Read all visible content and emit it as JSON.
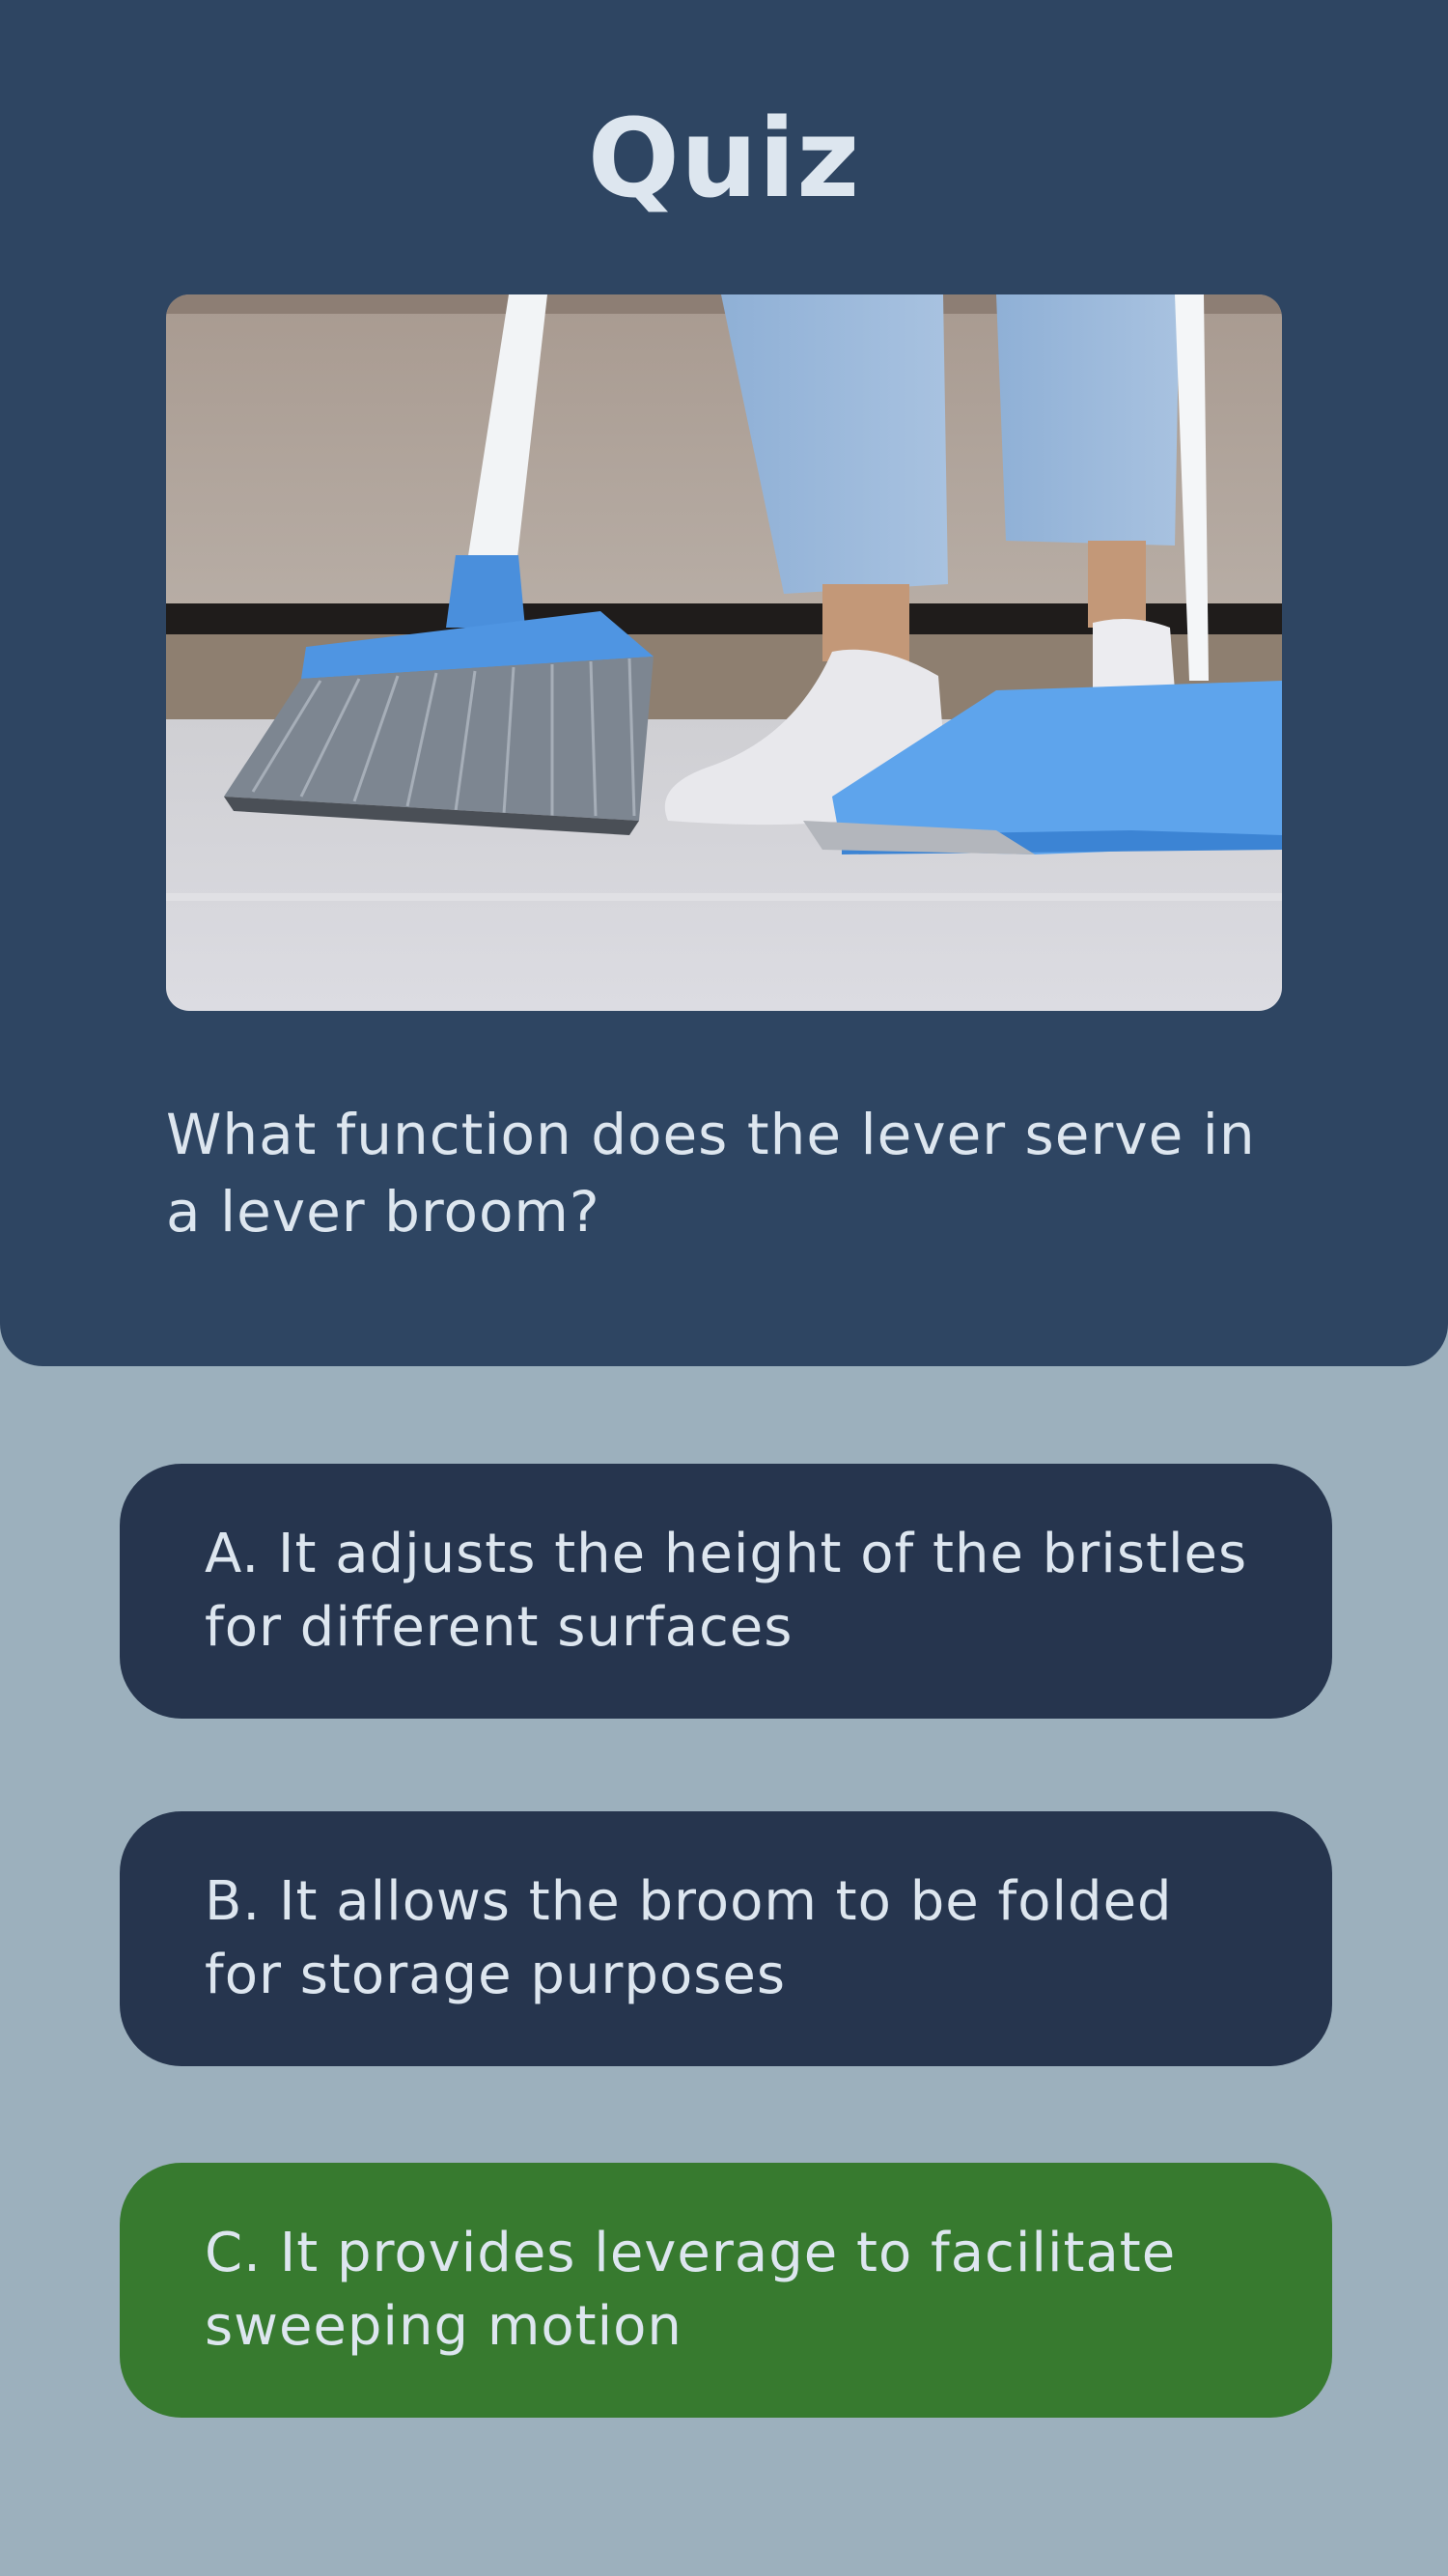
{
  "header": {
    "title": "Quiz"
  },
  "image": {
    "subject": "broom-and-dustpan-photo"
  },
  "question": {
    "text": "What function does the lever serve in a lever broom?"
  },
  "options": [
    {
      "text": "A. It adjusts the height of the bristles for different surfaces",
      "state": "default"
    },
    {
      "text": "B. It allows the broom to be folded for storage purposes",
      "state": "default"
    },
    {
      "text": "C. It provides leverage to facilitate sweeping motion",
      "state": "correct"
    }
  ],
  "colors": {
    "page_background": "#9cb0bd",
    "header_background": "#2e4562",
    "option_background": "#26354e",
    "correct_background": "#377a2f",
    "text": "#dde6ef"
  }
}
